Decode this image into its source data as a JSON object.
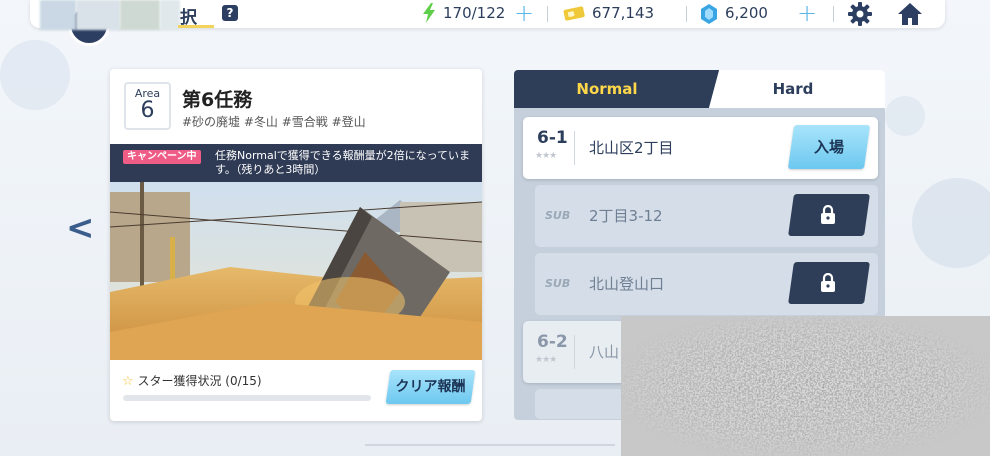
{
  "header": {
    "title_visible_fragment": "択",
    "help_label": "?",
    "stamina": "170/122",
    "credits": "677,143",
    "gems": "6,200",
    "plus_label": "+"
  },
  "nav": {
    "prev_label": "<"
  },
  "area": {
    "area_label": "Area",
    "area_number": "6",
    "title": "第6任務",
    "tags": "#砂の廃墟 #冬山 #雪合戦 #登山",
    "campaign_badge": "キャンペーン中",
    "campaign_text": "任務Normalで獲得できる報酬量が2倍になっています。（残りあと3時間）",
    "star_status": "スター獲得状況 (0/15)",
    "star_progress": 0,
    "reward_button": "クリア報酬"
  },
  "stage_panel": {
    "tabs": [
      {
        "label": "Normal",
        "active": true
      },
      {
        "label": "Hard",
        "active": false
      }
    ],
    "stages": [
      {
        "id": "6-1",
        "name": "北山区2丁目",
        "type": "main",
        "action": "入場"
      },
      {
        "tag": "SUB",
        "name": "2丁目3-12",
        "type": "sub",
        "locked": true
      },
      {
        "tag": "SUB",
        "name": "北山登山口",
        "type": "sub",
        "locked": true
      },
      {
        "id": "6-2",
        "name": "八山",
        "type": "main-partial"
      }
    ],
    "stars_glyph": "★★★"
  },
  "colors": {
    "accent_blue": "#6cc8ef",
    "navy": "#2f3e58",
    "tab_active_text": "#ffd84a",
    "campaign_pink": "#ef5c86",
    "star_gold": "#f2c53d"
  },
  "icons": [
    "stamina-bolt-icon",
    "credit-ticket-icon",
    "gem-icon",
    "gear-icon",
    "home-icon",
    "lock-icon",
    "star-icon"
  ]
}
